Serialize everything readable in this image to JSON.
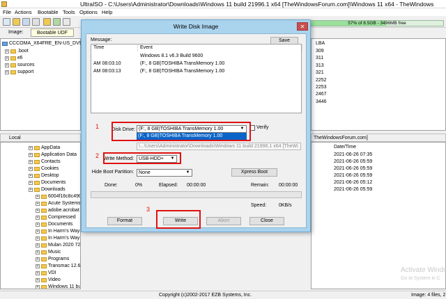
{
  "window": {
    "title": "UltraISO - C:\\Users\\Administrator\\Downloads\\Windows 11 build 21996.1  x64  [TheWindowsForum.com]\\Windows 11 x64 - TheWindows"
  },
  "menu": [
    "File",
    "Actions",
    "Bootable",
    "Tools",
    "Options",
    "Help"
  ],
  "image_bar": {
    "label": "Image:",
    "value": "Bootable UDF"
  },
  "usage": {
    "text": "57% of 8.5GB - 3496MB free",
    "fraction": 0.57
  },
  "iso_tree": {
    "root": "CCCOMA_X64FRE_EN-US_DV9",
    "items": [
      ".boot",
      "efi",
      "sources",
      "support"
    ]
  },
  "iso_lba": {
    "header": "LBA",
    "values": [
      "309",
      "311",
      "313",
      "321",
      "2252",
      "2253",
      "2467",
      "3446"
    ]
  },
  "local": {
    "header": "Local",
    "items": [
      "AppData",
      "Application Data",
      "Contacts",
      "Cookies",
      "Desktop",
      "Documents",
      "Downloads",
      "6004f16c8c490",
      "Acute Systems",
      "adobe.acrobat",
      "Compressed",
      "Documents",
      "In Harm's Way",
      "In Harm's Way",
      "Mulan 2020 720",
      "Music",
      "Programs",
      "Transmac 12.6.2",
      "VDI",
      "Video",
      "Windows 11 buil"
    ]
  },
  "local_files": {
    "path": "TheWindowsForum.com]",
    "header": "Date/Time",
    "dates": [
      "2021-06-26 07:35",
      "2021-06-26 05:59",
      "2021-06-26 05:59",
      "2021-06-26 05:59",
      "2021-06-26 05:12",
      "2021-06-26 05:59"
    ]
  },
  "activate": {
    "line1": "Activate Windo",
    "line2": "Go to System in C"
  },
  "status": {
    "copyright": "Copyright (c)2002-2017 EZB Systems, Inc.",
    "image": "Image: 4 files, 2"
  },
  "dialog": {
    "title": "Write Disk Image",
    "close": "✕",
    "message_label": "Message:",
    "save": "Save",
    "log_headers": [
      "Time",
      "Event"
    ],
    "log_rows": [
      {
        "time": "",
        "event": "Windows 8.1 v6.3 Build 9600"
      },
      {
        "time": "AM 08:03:10",
        "event": "(F:, 8 GB)TOSHIBA TransMemory    1.00"
      },
      {
        "time": "AM 08:03:13",
        "event": "(F:, 8 GB)TOSHIBA TransMemory    1.00"
      }
    ],
    "disk_drive_label": "Disk Drive:",
    "disk_drive_value": "(F:, 8 GB)TOSHIBA TransMemory    1.00",
    "disk_drive_option": "(F:, 8 GB)TOSHIBA TransMemory    1.00",
    "verify_label": "Verify",
    "image_file_partial": "\\...\\Users\\Administrator\\Downloads\\Windows 11 build 21996.1  x64  [TheWi",
    "write_method_label": "Write Method:",
    "write_method_value": "USB-HDD+",
    "hide_boot_label": "Hide Boot Partition:",
    "hide_boot_value": "None",
    "xpress_boot": "Xpress Boot",
    "done_label": "Done:",
    "done_value": "0%",
    "elapsed_label": "Elapsed:",
    "elapsed_value": "00:00:00",
    "remain_label": "Remain:",
    "remain_value": "00:00:00",
    "speed_label": "Speed:",
    "speed_value": "0KB/s",
    "progress": 0,
    "buttons": {
      "format": "Format",
      "write": "Write",
      "abort": "Abort",
      "close": "Close"
    },
    "annotations": [
      "1",
      "2",
      "3"
    ],
    "accent_red": "#e01010"
  }
}
